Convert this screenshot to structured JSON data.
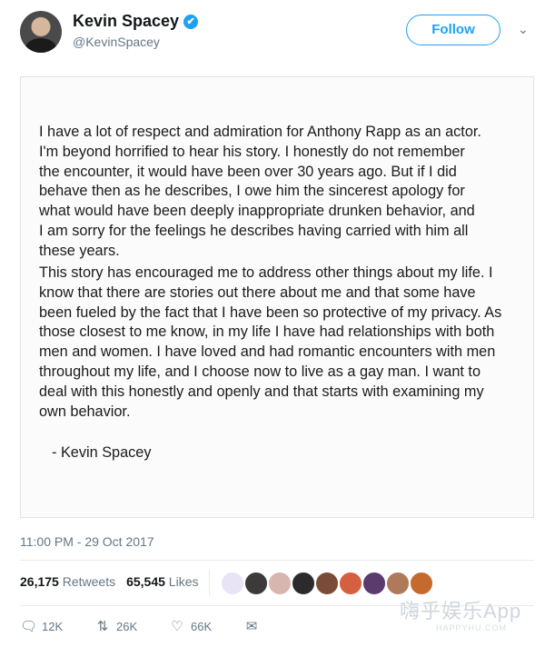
{
  "header": {
    "display_name": "Kevin Spacey",
    "verified_icon": "✔",
    "handle": "@KevinSpacey",
    "follow_label": "Follow",
    "menu_icon": "chevron-down-icon"
  },
  "statement": {
    "paragraph1": "I have a lot of respect and admiration for Anthony Rapp as an actor.\nI'm beyond horrified to hear his story. I honestly do not remember\nthe encounter, it would have been over 30 years ago. But if I did\nbehave then as he describes, I owe him the sincerest apology for\nwhat would have been deeply inappropriate drunken behavior, and\nI am sorry for the feelings he describes having carried with him all\nthese years.",
    "paragraph2": "This story has encouraged me to address other things about my life. I\nknow that there are stories out there about me and that some have\nbeen fueled by the fact that I have been so protective of my privacy. As\nthose closest to me know, in my life I have had relationships with both\nmen and women. I have loved and had romantic encounters with men\nthroughout my life, and I choose now to live as a gay man.  I want to\ndeal with this honestly and openly and that starts with examining my\nown behavior.",
    "signature": "- Kevin Spacey"
  },
  "tweet": {
    "timestamp": "11:00 PM - 29 Oct 2017",
    "retweets_count": "26,175",
    "retweets_label": "Retweets",
    "likes_count": "65,545",
    "likes_label": "Likes"
  },
  "actions": {
    "reply_count": "12K",
    "retweet_count": "26K",
    "like_count": "66K"
  },
  "watermark": {
    "text": "嗨乎娱乐App",
    "sub": "HAPPYHU.COM"
  },
  "colors": {
    "accent": "#1da1f2",
    "muted": "#657786"
  }
}
